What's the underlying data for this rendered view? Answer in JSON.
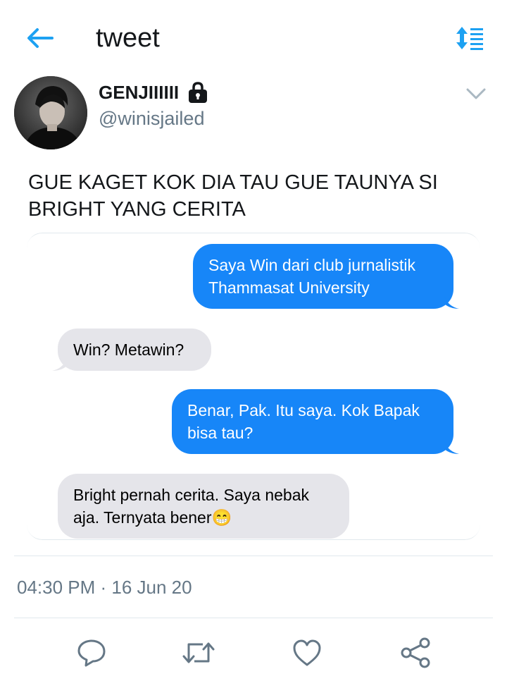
{
  "header": {
    "title": "tweet",
    "back_icon": "back-arrow-icon",
    "sort_icon": "sort-toggle-icon",
    "accent_color": "#1da1f2"
  },
  "author": {
    "name": "GENJIIIIII",
    "handle": "@winisjailed",
    "protected_icon": "lock-icon",
    "avatar": "profile-photo"
  },
  "tweet": {
    "text": "GUE KAGET KOK DIA TAU GUE TAUNYA SI BRIGHT YANG CERITA",
    "timestamp": "04:30 PM · 16 Jun 20"
  },
  "chat": {
    "sent_color": "#1786f8",
    "received_color": "#e5e5ea",
    "messages": [
      {
        "side": "sent",
        "text": "Saya Win dari club jurnalistik Thammasat University"
      },
      {
        "side": "received",
        "text": "Win? Metawin?"
      },
      {
        "side": "sent",
        "text": "Benar, Pak. Itu saya. Kok Bapak bisa tau?"
      },
      {
        "side": "received",
        "text": "Bright pernah cerita. Saya nebak aja. Ternyata bener😁"
      }
    ]
  },
  "actions": [
    {
      "name": "reply",
      "icon": "reply-icon"
    },
    {
      "name": "retweet",
      "icon": "retweet-icon"
    },
    {
      "name": "like",
      "icon": "heart-icon"
    },
    {
      "name": "share",
      "icon": "share-icon"
    }
  ]
}
